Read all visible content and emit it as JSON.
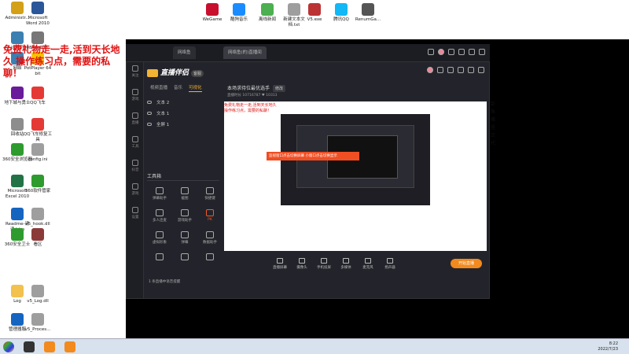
{
  "overlay_text": "免费礼物走一走,活到天长地久 操作练习点，需要的私聊！",
  "desktop_icons": [
    {
      "label": "Administr...",
      "color": "#d4a017"
    },
    {
      "label": "Microsoft Word 2010",
      "color": "#2b579a"
    },
    {
      "label": "WeGame",
      "color": "#c8102e"
    },
    {
      "label": "酷狗音乐",
      "color": "#1a8cff"
    },
    {
      "label": "离线新闻",
      "color": "#4caf50"
    },
    {
      "label": "新建文本文档.txt",
      "color": "#9e9e9e"
    },
    {
      "label": "V5.exe",
      "color": "#b33"
    },
    {
      "label": "腾讯QQ",
      "color": "#12b7f5"
    },
    {
      "label": "RenumGa...",
      "color": "#555"
    },
    {
      "label": "计算机",
      "color": "#3c7fb1"
    },
    {
      "label": "60848_206...",
      "color": "#777"
    },
    {
      "label": "网络",
      "color": "#3c7fb1"
    },
    {
      "label": "PotPlayer 64 bit",
      "color": "#f5c400"
    },
    {
      "label": "地下城与勇士",
      "color": "#6a1b9a"
    },
    {
      "label": "QQ飞车",
      "color": "#e53935"
    },
    {
      "label": "回收站",
      "color": "#8d8d8d"
    },
    {
      "label": "QQ飞车修复工具",
      "color": "#e53935"
    },
    {
      "label": "360安全浏览器",
      "color": "#2e9b2e"
    },
    {
      "label": "config.ini",
      "color": "#9e9e9e"
    },
    {
      "label": "Microsoft Excel 2010",
      "color": "#217346"
    },
    {
      "label": "360软件管家",
      "color": "#2e9b2e"
    },
    {
      "label": "Readme-请读.htm",
      "color": "#1565c0"
    },
    {
      "label": "v5_hook.dll",
      "color": "#9e9e9e"
    },
    {
      "label": "360安全卫士",
      "color": "#2e9b2e"
    },
    {
      "label": "看区",
      "color": "#8b3a3a"
    },
    {
      "label": "Log",
      "color": "#f2c14e"
    },
    {
      "label": "v5_Log.dll",
      "color": "#9e9e9e"
    },
    {
      "label": "管理器服",
      "color": "#1565c0"
    },
    {
      "label": "v5_Proces...",
      "color": "#9e9e9e"
    }
  ],
  "browser_tabs": [
    "网络鱼",
    "网络鱼(的)直播间"
  ],
  "app": {
    "logo_text": "直播伴侣",
    "version_badge": "客服",
    "sidebar": [
      "关注",
      "游戏",
      "直播",
      "工具",
      "抖音",
      "游戏",
      "设置"
    ],
    "panel_tabs": [
      "视频直播",
      "音乐",
      "可视化"
    ],
    "sources": [
      "文本 2",
      "文本 1",
      "全屏 1"
    ],
    "tools_title": "工具箱",
    "tools": [
      "弹幕助手",
      "截图",
      "快捷键",
      "多人连麦",
      "游戏助手",
      "PK",
      "虚拟形象",
      "弹幕",
      "数据助手",
      "",
      "",
      ""
    ],
    "footer_note": "1 条直播中语音提醒",
    "stream_title": "本场求待位最优选手",
    "stream_title_btn": "修改",
    "meta": "直播时长 10716787  ♥ 10313",
    "toast": "监视窗口点击切换屏幕  小窗口点击切换显示",
    "red_preview_text": "免费礼物走一走,活到天长地久 操作练习点，需要的私聊！",
    "bottom_buttons": [
      "直播屏幕",
      "摄像头",
      "手机投屏",
      "多媒体",
      "麦克风",
      "扬声器"
    ],
    "go_live": "开始直播"
  },
  "taskbar": {
    "time": "8:22",
    "date": "2022/7/23"
  },
  "right_strip": [
    "卦",
    "鱼",
    "嘴",
    "里",
    "正",
    "代"
  ]
}
